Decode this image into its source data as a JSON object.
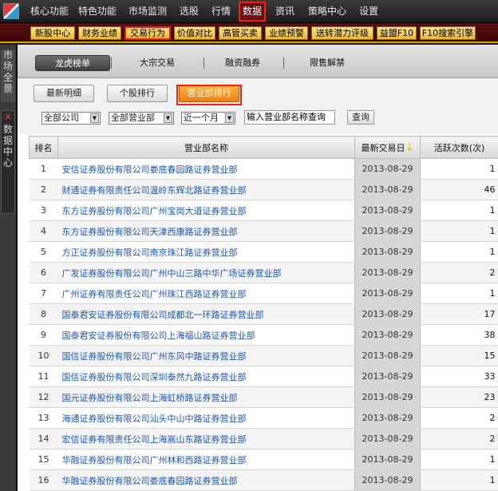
{
  "menu": {
    "items": [
      "核心功能",
      "特色功能",
      "市场监测",
      "选股",
      "行情",
      "数据",
      "资讯",
      "策略中心",
      "设置"
    ],
    "active": "数据"
  },
  "submenu": {
    "items": [
      "新股中心",
      "财务业绩",
      "交易行为",
      "价值对比",
      "高管买卖",
      "业绩预警",
      "送转潜力评级",
      "益盟F10",
      "F10搜索引擎"
    ],
    "active": "交易行为"
  },
  "leftbar": {
    "tab1": "市场全景",
    "tab2_close": "×",
    "tab2": "数据中心"
  },
  "tabs": {
    "items": [
      "龙虎榜单",
      "大宗交易",
      "融资融券",
      "限售解禁"
    ],
    "active": "龙虎榜单"
  },
  "subtabs": {
    "items": [
      "最新明细",
      "个股排行",
      "营业部排行"
    ],
    "active": "营业部排行"
  },
  "filters": {
    "company": "全部公司",
    "branch": "全部营业部",
    "period": "近一个月",
    "search_value": "输入营业部名称查询",
    "query_label": "查询"
  },
  "table": {
    "headers": {
      "rank": "排名",
      "name": "营业部名称",
      "date": "最新交易日",
      "count": "活跃次数(次)"
    },
    "rows": [
      {
        "rank": "1",
        "name": "安信证券股份有限公司娄底春园路证券营业部",
        "date": "2013-08-29",
        "count": "1"
      },
      {
        "rank": "2",
        "name": "财通证券有限责任公司温岭东辉北路证券营业部",
        "date": "2013-08-29",
        "count": "46"
      },
      {
        "rank": "3",
        "name": "东方证券股份有限公司广州宝岗大道证券营业部",
        "date": "2013-08-29",
        "count": "1"
      },
      {
        "rank": "4",
        "name": "东方证券股份有限公司天津西康路证券营业部",
        "date": "2013-08-29",
        "count": "1"
      },
      {
        "rank": "5",
        "name": "方正证券股份有限公司南京珠江路证券营业部",
        "date": "2013-08-29",
        "count": "1"
      },
      {
        "rank": "6",
        "name": "广发证券股份有限公司广州中山三路中华广场证券营业部",
        "date": "2013-08-29",
        "count": "2"
      },
      {
        "rank": "7",
        "name": "广州证券有限责任公司广州珠江西路证券营业部",
        "date": "2013-08-29",
        "count": "1"
      },
      {
        "rank": "8",
        "name": "国泰君安证券股份有限公司成都北一环路证券营业部",
        "date": "2013-08-29",
        "count": "17"
      },
      {
        "rank": "9",
        "name": "国泰君安证券股份有限公司上海福山路证券营业部",
        "date": "2013-08-29",
        "count": "38"
      },
      {
        "rank": "10",
        "name": "国信证券股份有限公司广州东风中路证券营业部",
        "date": "2013-08-29",
        "count": "15"
      },
      {
        "rank": "11",
        "name": "国信证券股份有限公司深圳泰然九路证券营业部",
        "date": "2013-08-29",
        "count": "33"
      },
      {
        "rank": "12",
        "name": "国元证券股份有限公司上海虹桥路证券营业部",
        "date": "2013-08-29",
        "count": "23"
      },
      {
        "rank": "13",
        "name": "海通证券股份有限公司汕头中山中路证券营业部",
        "date": "2013-08-29",
        "count": "2"
      },
      {
        "rank": "14",
        "name": "宏信证券有限责任公司上海嵩山东路证券营业部",
        "date": "2013-08-29",
        "count": "2"
      },
      {
        "rank": "15",
        "name": "华融证券股份有限公司广州林和西路证券营业部",
        "date": "2013-08-29",
        "count": "1"
      },
      {
        "rank": "16",
        "name": "华融证券股份有限公司娄底春园路证券营业部",
        "date": "2013-08-29",
        "count": "1"
      }
    ]
  },
  "icons": {
    "logo": "app-logo-icon",
    "sort": "sort-down-icon",
    "dropdown": "dropdown-arrow-icon"
  },
  "colors": {
    "highlight": "#e02020",
    "accent_orange": "#f07f10",
    "link_blue": "#1a55b8",
    "subbar_gold": "#e5b53a"
  }
}
